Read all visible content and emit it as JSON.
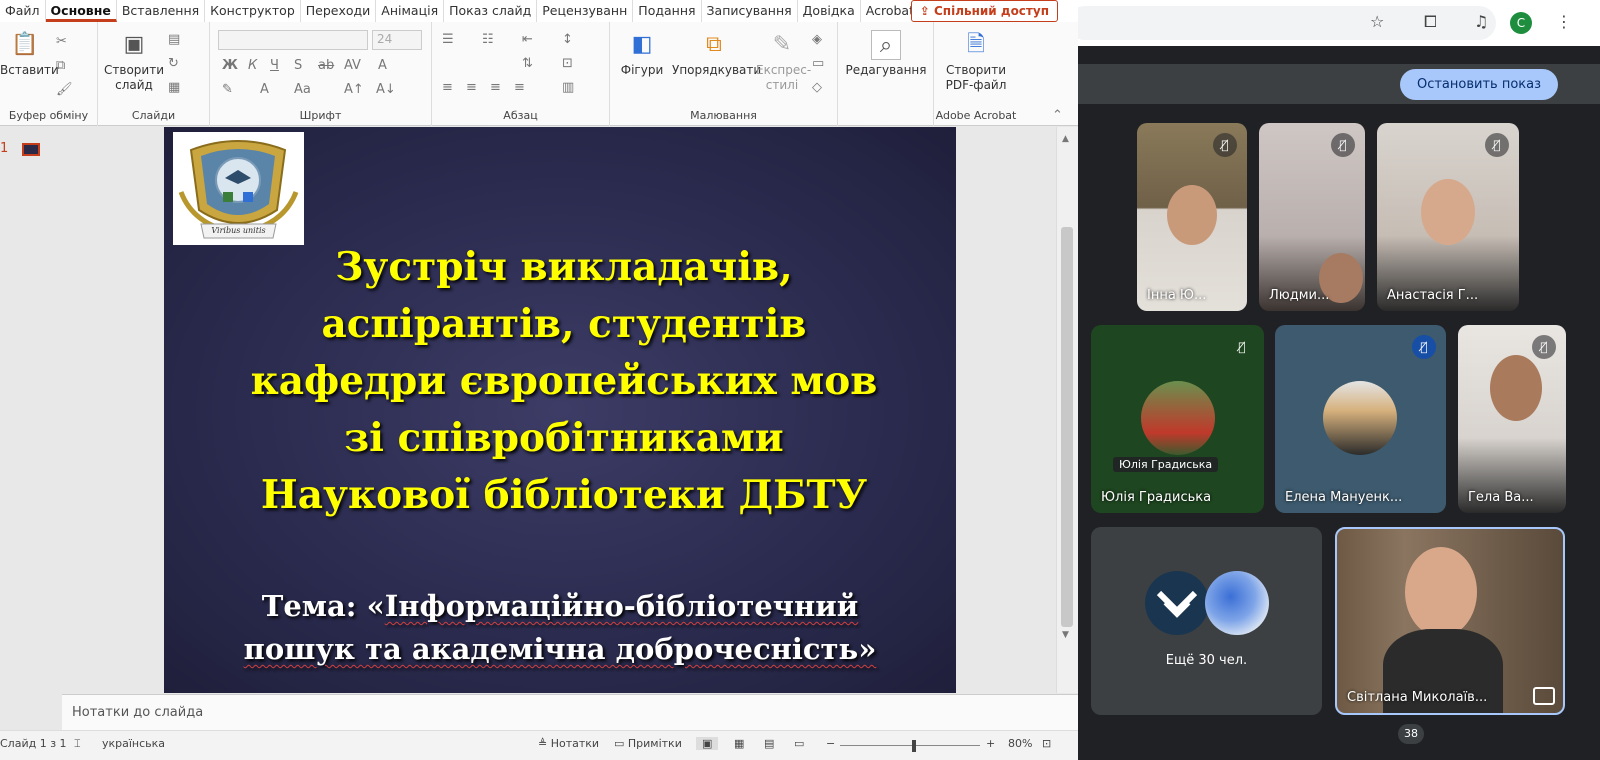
{
  "ppt": {
    "tabs": [
      "Файл",
      "Основне",
      "Вставлення",
      "Конструктор",
      "Переходи",
      "Анімація",
      "Показ слайд",
      "Рецензуванн",
      "Подання",
      "Записування",
      "Довідка",
      "Acrobat"
    ],
    "share": "Спільний доступ",
    "ribbon": {
      "paste": "Вставити",
      "new_slide": "Створити слайд",
      "font_size": "24",
      "shapes": "Фігури",
      "arrange": "Упорядкувати",
      "quick_styles": "Експрес-стилі",
      "editing": "Редагування",
      "create_pdf": "Створити PDF-файл",
      "groups": {
        "clipboard": "Буфер обміну",
        "slides": "Слайди",
        "font": "Шрифт",
        "paragraph": "Абзац",
        "drawing": "Малювання",
        "acrobat": "Adobe Acrobat"
      }
    },
    "thumb_number": "1",
    "slide": {
      "logo_motto": "Viribus unitis",
      "title_lines": [
        "Зустріч викладачів,",
        "аспірантів, студентів",
        "кафедри європейських мов",
        "зі співробітниками",
        "Наукової бібліотеки ДБТУ"
      ],
      "topic_prefix": "Тема: «",
      "topic_line1_word": "Інформаційно-бібліотечний",
      "topic_line2": "пошук та академічна доброчесність»"
    },
    "notes_label": "Нотатки до слайда",
    "status": {
      "slide_pos": "Слайд 1 з 1",
      "language": "українська",
      "notes_btn": "Нотатки",
      "comments_btn": "Примітки",
      "zoom": "80%"
    }
  },
  "browser": {
    "profile_letter": "C",
    "stop_presenting": "Остановить показ",
    "participants": [
      {
        "name": "Інна Ю..."
      },
      {
        "name": "Людми..."
      },
      {
        "name": "Анастасія Г..."
      },
      {
        "name": "Юлія Градиська",
        "caption": "Юлія Градиська"
      },
      {
        "name": "Елена Мануенк..."
      },
      {
        "name": "Гела Ва..."
      },
      {
        "name": "Ещё 30 чел."
      },
      {
        "name": "Світлана Миколаїв..."
      }
    ],
    "count_badge": "38"
  },
  "colors": {
    "ppt_accent": "#c43e1c",
    "slide_title": "#ffff00",
    "meet_btn": "#a8c7fa"
  }
}
